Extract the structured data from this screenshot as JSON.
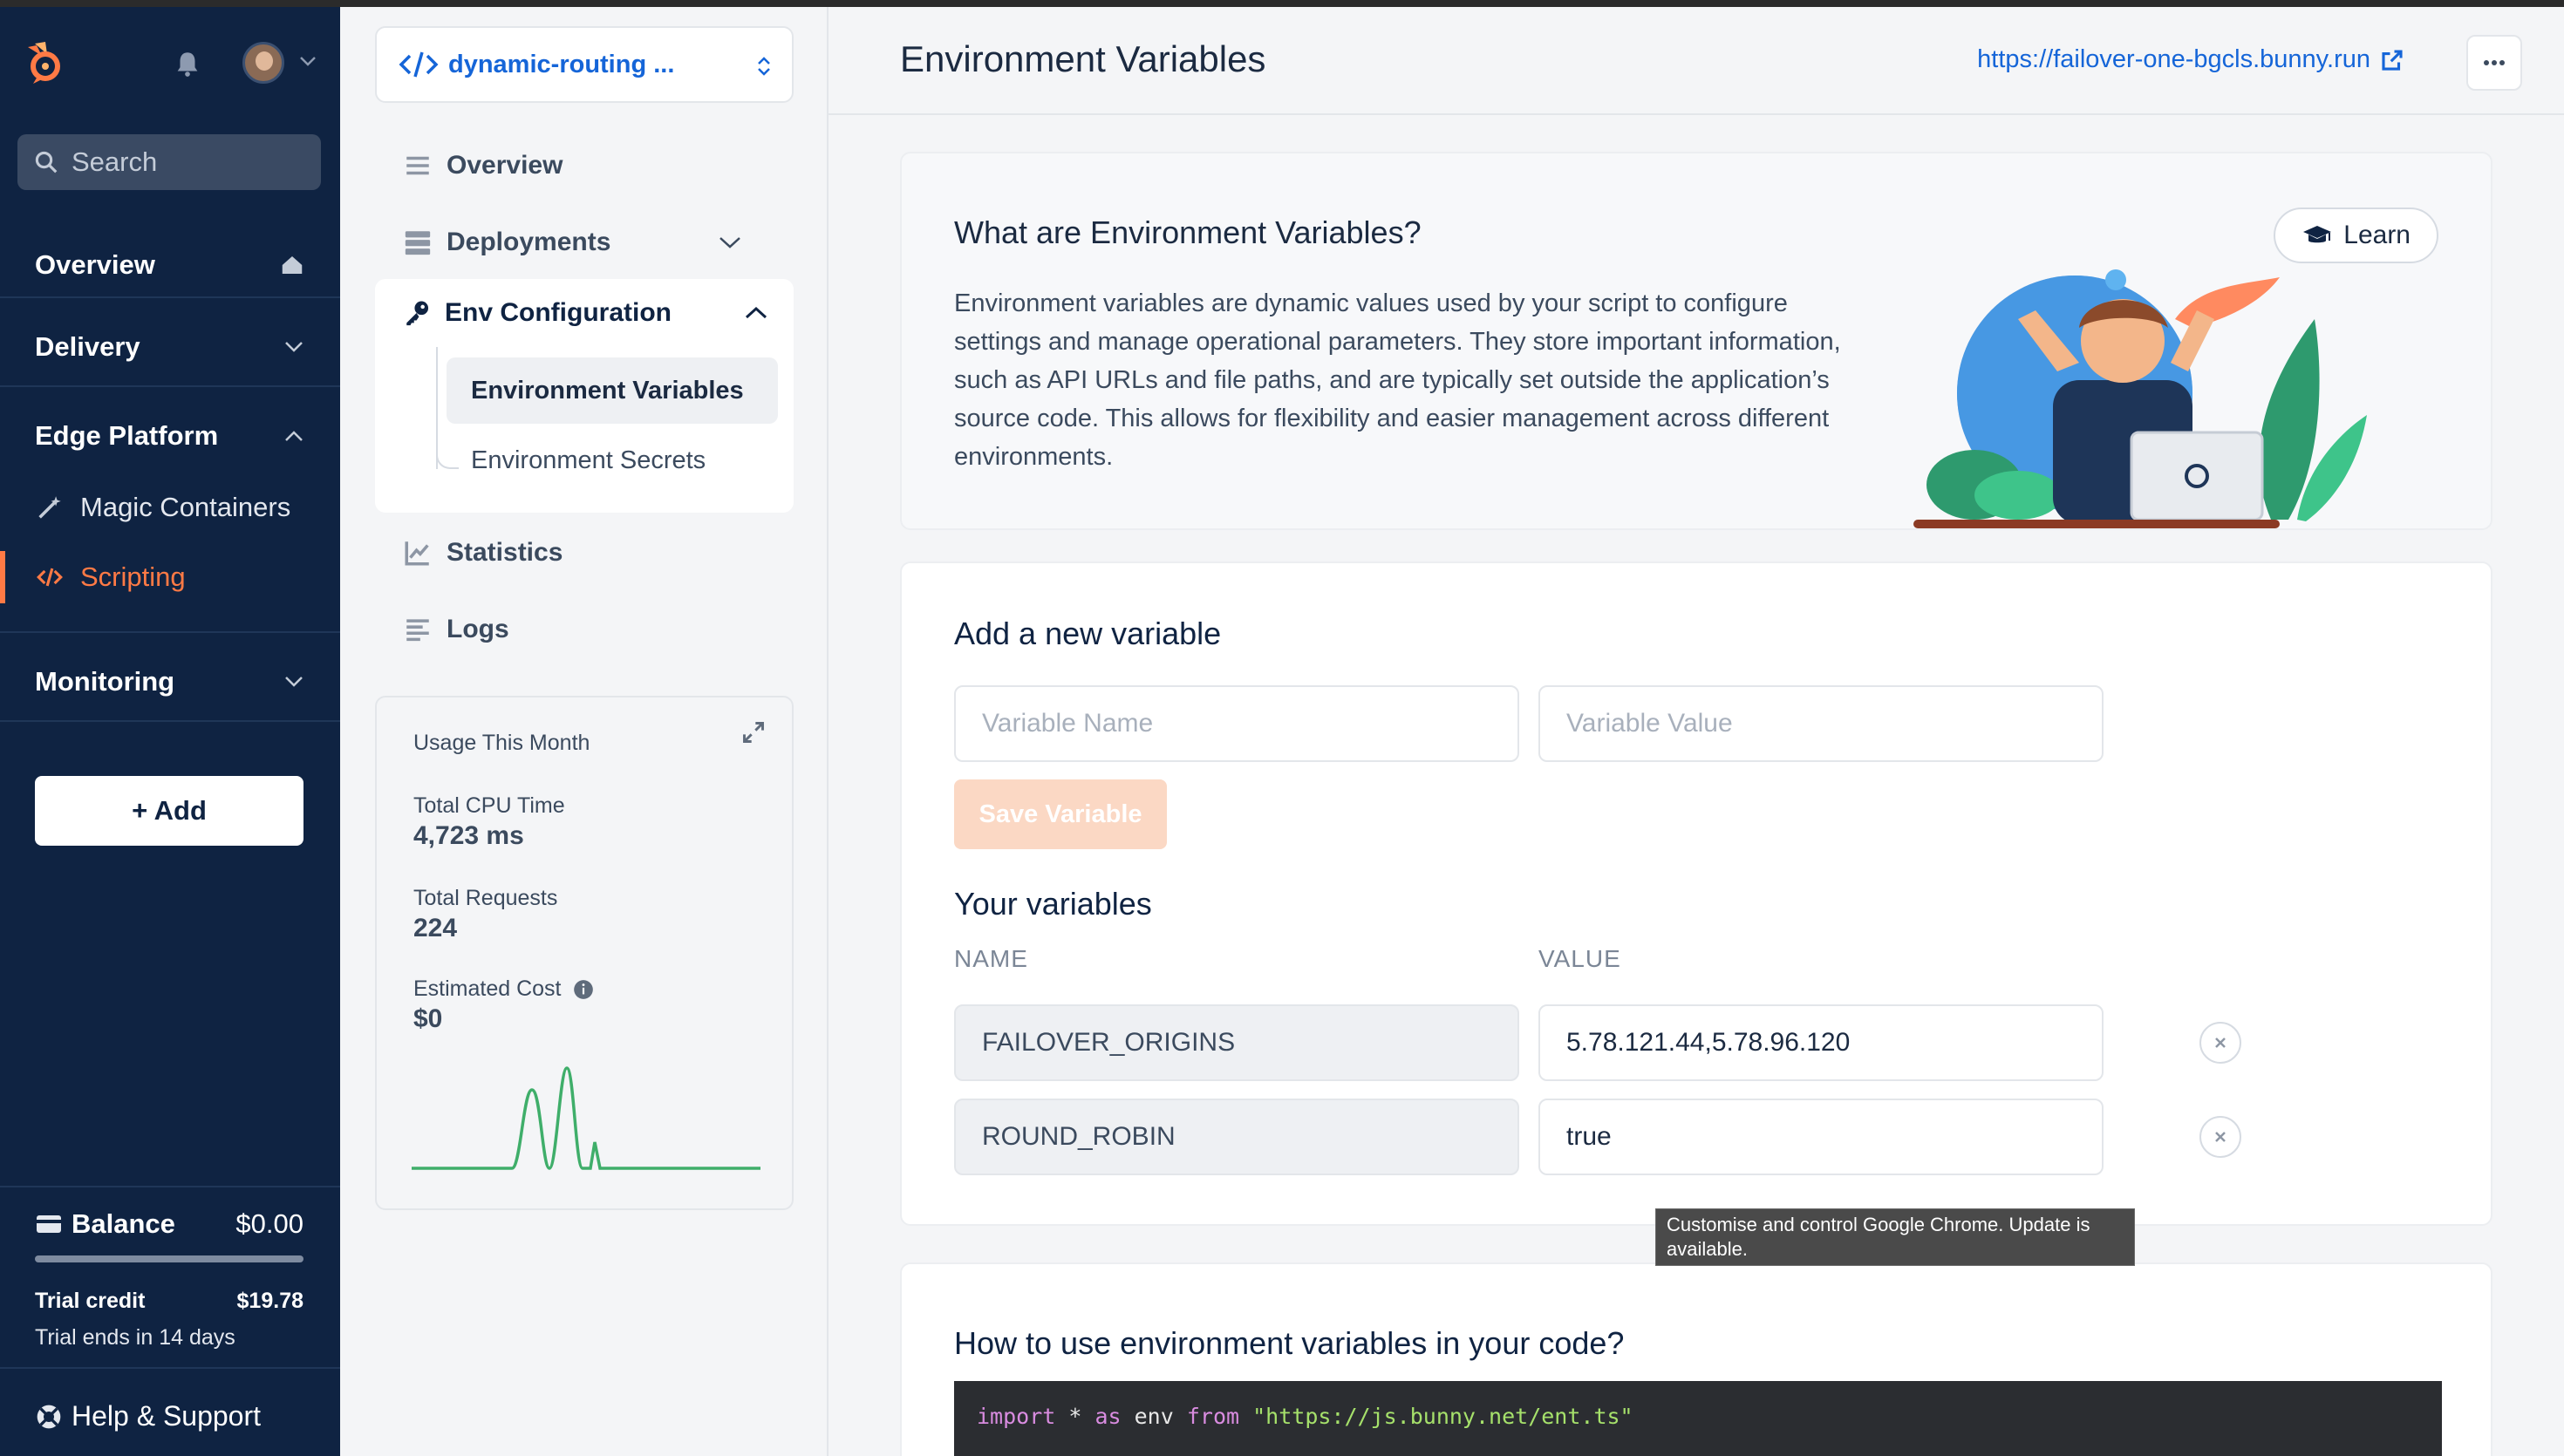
{
  "nav": {
    "search_placeholder": "Search",
    "sections": {
      "overview": "Overview",
      "delivery": "Delivery",
      "edge_platform": "Edge Platform",
      "monitoring": "Monitoring"
    },
    "edge_items": [
      {
        "label": "Magic Containers"
      },
      {
        "label": "Scripting"
      }
    ],
    "add_label": "+ Add",
    "balance_label": "Balance",
    "balance_value": "$0.00",
    "trial_credit_label": "Trial credit",
    "trial_credit_value": "$19.78",
    "trial_ends": "Trial ends in 14 days",
    "help_label": "Help & Support",
    "accent": "#ff7a45",
    "bg": "#0f2342"
  },
  "sub": {
    "script_name": "dynamic-routing ...",
    "items": {
      "overview": "Overview",
      "deployments": "Deployments",
      "env_config": "Env Configuration",
      "env_variables": "Environment Variables",
      "env_secrets": "Environment Secrets",
      "statistics": "Statistics",
      "logs": "Logs"
    },
    "usage": {
      "title": "Usage This Month",
      "cpu_label": "Total CPU Time",
      "cpu_value": "4,723 ms",
      "requests_label": "Total Requests",
      "requests_value": "224",
      "cost_label": "Estimated Cost",
      "cost_value": "$0"
    }
  },
  "main": {
    "title": "Environment Variables",
    "url": "https://failover-one-bgcls.bunny.run",
    "info": {
      "heading": "What are Environment Variables?",
      "body": "Environment variables are dynamic values used by your script to configure settings and manage operational parameters. They store important information, such as API URLs and file paths, and are typically set outside the application’s source code. This allows for flexibility and easier management across different environments.",
      "learn_label": "Learn"
    },
    "add": {
      "heading": "Add a new variable",
      "name_placeholder": "Variable Name",
      "value_placeholder": "Variable Value",
      "save_label": "Save Variable"
    },
    "vars": {
      "heading": "Your variables",
      "col_name": "NAME",
      "col_value": "VALUE",
      "rows": [
        {
          "name": "FAILOVER_ORIGINS",
          "value": "5.78.121.44,5.78.96.120"
        },
        {
          "name": "ROUND_ROBIN",
          "value": "true"
        }
      ]
    },
    "howto": {
      "heading": "How to use environment variables in your code?",
      "code_kw1": "import",
      "code_mid": " * ",
      "code_kw2": "as",
      "code_env": " env ",
      "code_kw3": "from",
      "code_str": " \"https://js.bunny.net/ent.ts\""
    },
    "tooltip": "Customise and control Google Chrome. Update is available.",
    "link_color": "#1565d8"
  }
}
